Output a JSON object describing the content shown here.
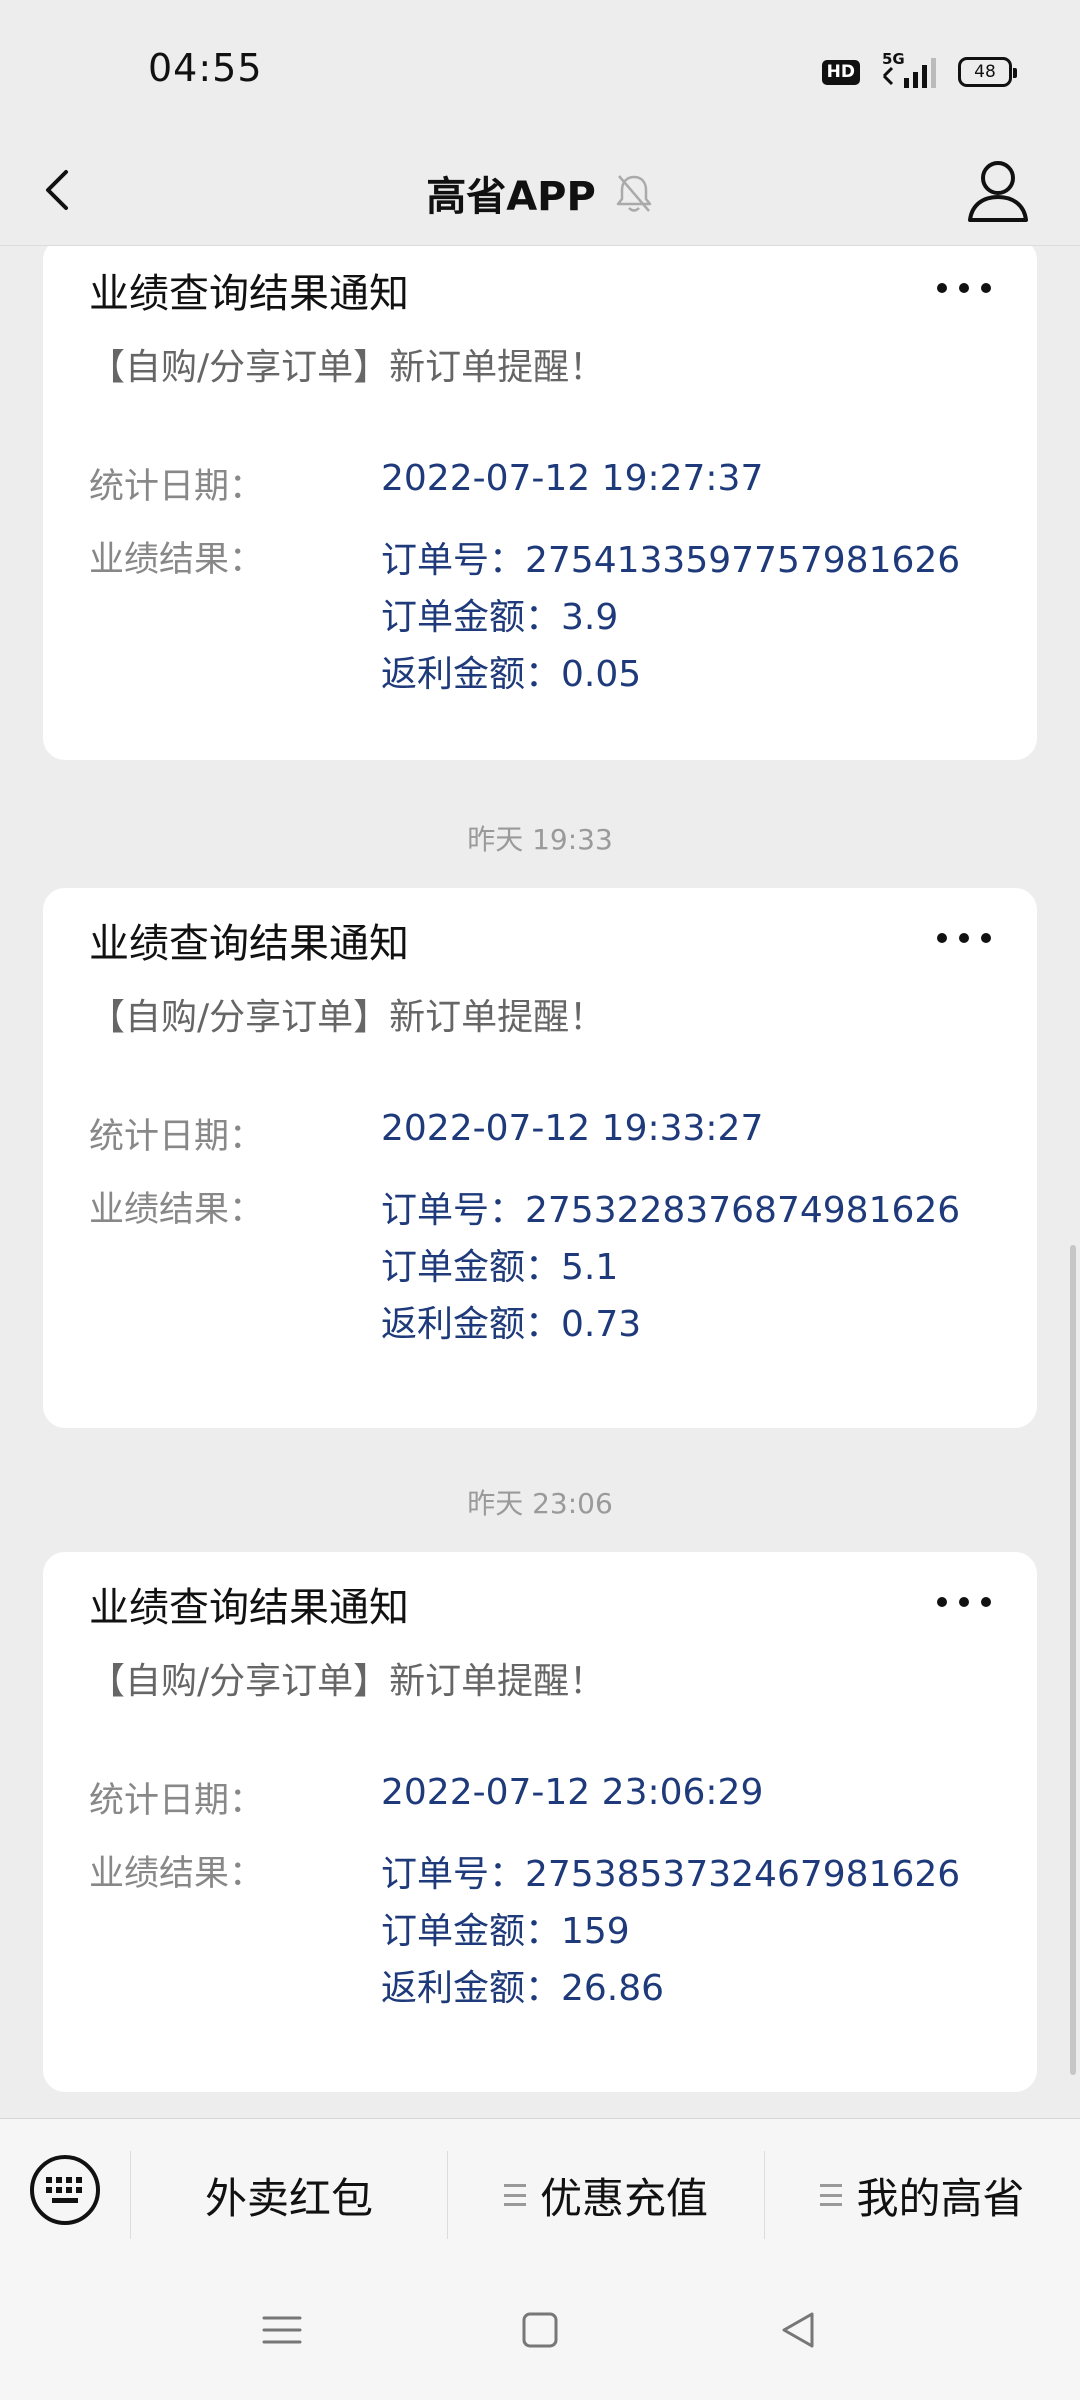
{
  "status_bar": {
    "time": "04:55",
    "hd": "HD",
    "network": "5G",
    "battery": "48"
  },
  "header": {
    "title": "高省APP"
  },
  "messages": [
    {
      "title": "业绩查询结果通知",
      "subtitle": "【自购/分享订单】新订单提醒！",
      "date_label": "统计日期：",
      "date_value": "2022-07-12 19:27:37",
      "result_label": "业绩结果：",
      "order_no": "订单号：2754133597757981626",
      "order_amount": "订单金额：3.9",
      "rebate_amount": "返利金额：0.05"
    },
    {
      "title": "业绩查询结果通知",
      "subtitle": "【自购/分享订单】新订单提醒！",
      "date_label": "统计日期：",
      "date_value": "2022-07-12 19:33:27",
      "result_label": "业绩结果：",
      "order_no": "订单号：2753228376874981626",
      "order_amount": "订单金额：5.1",
      "rebate_amount": "返利金额：0.73"
    },
    {
      "title": "业绩查询结果通知",
      "subtitle": "【自购/分享订单】新订单提醒！",
      "date_label": "统计日期：",
      "date_value": "2022-07-12 23:06:29",
      "result_label": "业绩结果：",
      "order_no": "订单号：2753853732467981626",
      "order_amount": "订单金额：159",
      "rebate_amount": "返利金额：26.86"
    }
  ],
  "timestamps": [
    "昨天 19:33",
    "昨天 23:06"
  ],
  "bottom_menu": {
    "items": [
      "外卖红包",
      "优惠充值",
      "我的高省"
    ]
  },
  "icons": {
    "back": "chevron-left-icon",
    "mute": "bell-off-icon",
    "profile": "person-icon",
    "more": "more-dots-icon",
    "keyboard": "keyboard-icon",
    "menu_marker": "menu-lines-icon",
    "sys_menu": "menu-icon",
    "sys_home": "square-icon",
    "sys_back": "triangle-back-icon"
  },
  "colors": {
    "background": "#ededed",
    "card": "#ffffff",
    "value_text": "#1e3a7a",
    "label_text": "#888888"
  }
}
